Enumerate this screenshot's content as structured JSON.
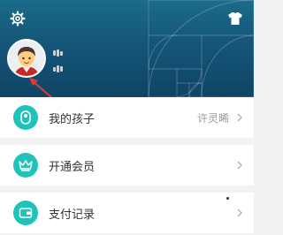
{
  "header": {
    "settings_icon": "gear-icon",
    "wardrobe_icon": "tshirt-icon",
    "background_color": "#15577a"
  },
  "profile": {
    "avatar_icon": "cartoon-avatar-icon"
  },
  "menu": {
    "accent_color": "#1fc3b9",
    "items": [
      {
        "icon": "child-icon",
        "label": "我的孩子",
        "value": "许灵晞"
      },
      {
        "icon": "crown-icon",
        "label": "开通会员",
        "value": ""
      },
      {
        "icon": "wallet-icon",
        "label": "支付记录",
        "value": ""
      }
    ]
  }
}
